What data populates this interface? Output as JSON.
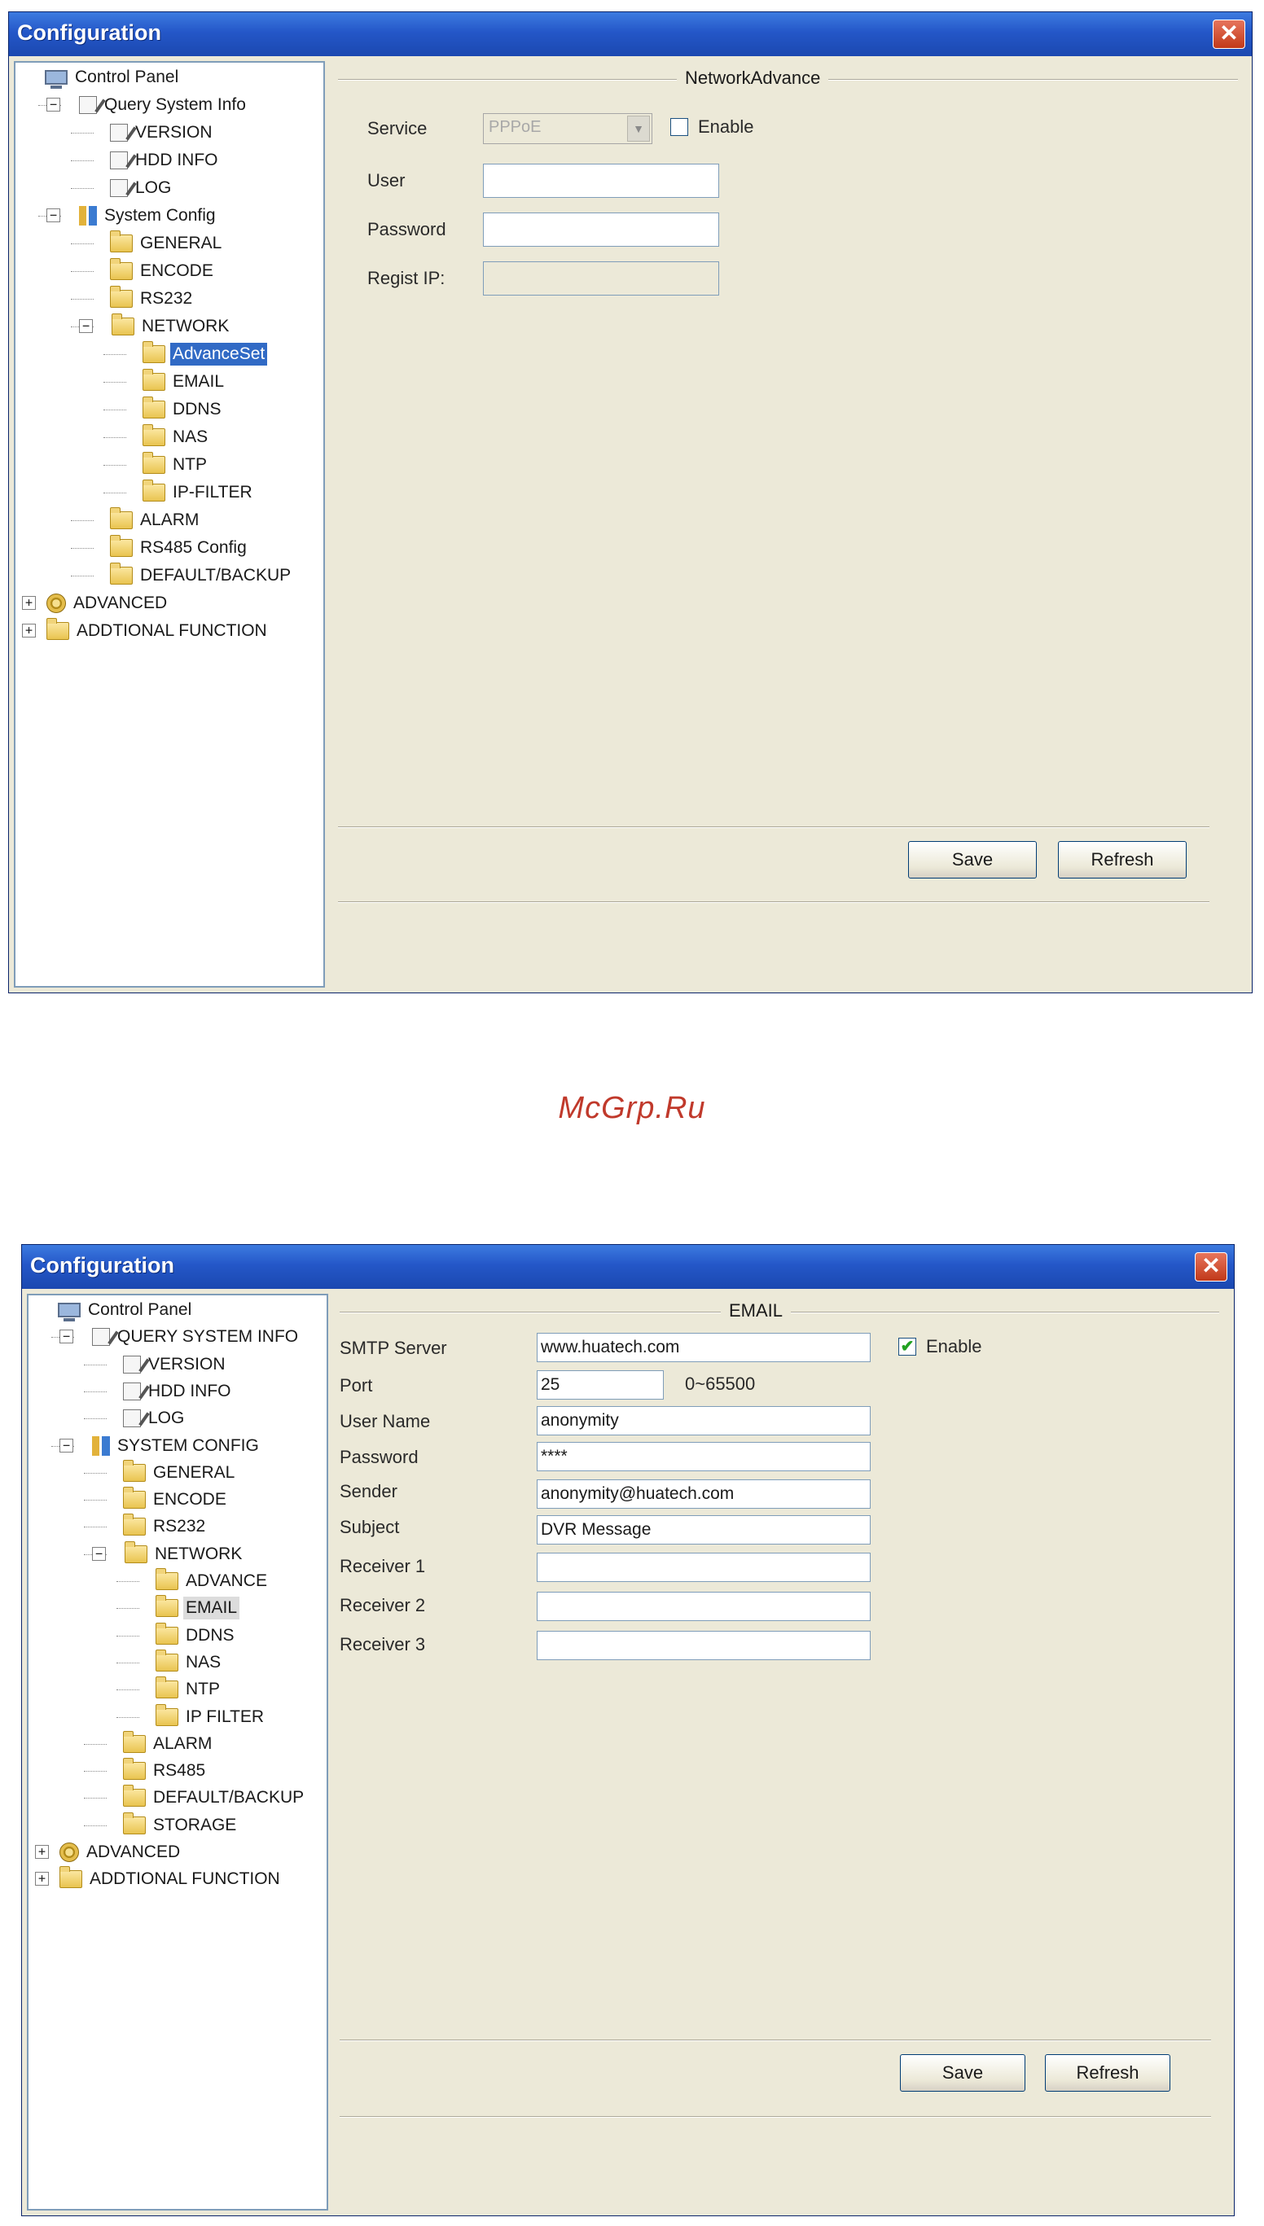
{
  "watermark": "McGrp.Ru",
  "window1": {
    "title": "Configuration",
    "close_glyph": "✕",
    "tree": [
      {
        "label": "Control Panel",
        "icon": "monitor-icon"
      },
      {
        "label": "Query System Info",
        "icon": "doc-icon",
        "expander": "−"
      },
      {
        "label": "VERSION",
        "icon": "doc-icon"
      },
      {
        "label": "HDD INFO",
        "icon": "doc-icon"
      },
      {
        "label": "LOG",
        "icon": "doc-icon"
      },
      {
        "label": "System Config",
        "icon": "tools-icon",
        "expander": "−"
      },
      {
        "label": "GENERAL",
        "icon": "folder-icon"
      },
      {
        "label": "ENCODE",
        "icon": "folder-icon"
      },
      {
        "label": "RS232",
        "icon": "folder-icon"
      },
      {
        "label": "NETWORK",
        "icon": "folder-icon",
        "expander": "−"
      },
      {
        "label": "AdvanceSet",
        "icon": "folder-icon",
        "selected": true
      },
      {
        "label": "EMAIL",
        "icon": "folder-icon"
      },
      {
        "label": "DDNS",
        "icon": "folder-icon"
      },
      {
        "label": "NAS",
        "icon": "folder-icon"
      },
      {
        "label": "NTP",
        "icon": "folder-icon"
      },
      {
        "label": "IP-FILTER",
        "icon": "folder-icon"
      },
      {
        "label": "ALARM",
        "icon": "folder-icon"
      },
      {
        "label": "RS485 Config",
        "icon": "folder-icon"
      },
      {
        "label": "DEFAULT/BACKUP",
        "icon": "folder-icon"
      },
      {
        "label": "ADVANCED",
        "icon": "gears-icon",
        "expander": "+"
      },
      {
        "label": "ADDTIONAL FUNCTION",
        "icon": "folder-icon",
        "expander": "+"
      }
    ],
    "panel": {
      "legend": "NetworkAdvance",
      "service_label": "Service",
      "service_value": "PPPoE",
      "enable_label": "Enable",
      "enable_checked": false,
      "user_label": "User",
      "user_value": "",
      "password_label": "Password",
      "password_value": "",
      "regist_ip_label": "Regist IP:",
      "regist_ip_value": "",
      "save_label": "Save",
      "refresh_label": "Refresh"
    }
  },
  "window2": {
    "title": "Configuration",
    "close_glyph": "✕",
    "tree": [
      {
        "label": "Control Panel",
        "icon": "monitor-icon"
      },
      {
        "label": "QUERY SYSTEM INFO",
        "icon": "doc-icon",
        "expander": "−"
      },
      {
        "label": "VERSION",
        "icon": "doc-icon"
      },
      {
        "label": "HDD INFO",
        "icon": "doc-icon"
      },
      {
        "label": "LOG",
        "icon": "doc-icon"
      },
      {
        "label": "SYSTEM CONFIG",
        "icon": "tools-icon",
        "expander": "−"
      },
      {
        "label": "GENERAL",
        "icon": "folder-icon"
      },
      {
        "label": "ENCODE",
        "icon": "folder-icon"
      },
      {
        "label": "RS232",
        "icon": "folder-icon"
      },
      {
        "label": "NETWORK",
        "icon": "folder-icon",
        "expander": "−"
      },
      {
        "label": "ADVANCE",
        "icon": "folder-icon"
      },
      {
        "label": "EMAIL",
        "icon": "folder-icon",
        "highlighted": true
      },
      {
        "label": "DDNS",
        "icon": "folder-icon"
      },
      {
        "label": "NAS",
        "icon": "folder-icon"
      },
      {
        "label": "NTP",
        "icon": "folder-icon"
      },
      {
        "label": "IP FILTER",
        "icon": "folder-icon"
      },
      {
        "label": "ALARM",
        "icon": "folder-icon"
      },
      {
        "label": "RS485",
        "icon": "folder-icon"
      },
      {
        "label": "DEFAULT/BACKUP",
        "icon": "folder-icon"
      },
      {
        "label": "STORAGE",
        "icon": "folder-icon"
      },
      {
        "label": "ADVANCED",
        "icon": "gears-icon",
        "expander": "+"
      },
      {
        "label": "ADDTIONAL FUNCTION",
        "icon": "folder-icon",
        "expander": "+"
      }
    ],
    "panel": {
      "legend": "EMAIL",
      "smtp_label": "SMTP Server",
      "smtp_value": "www.huatech.com",
      "enable_label": "Enable",
      "enable_checked": true,
      "port_label": "Port",
      "port_value": "25",
      "port_range": "0~65500",
      "username_label": "User Name",
      "username_value": "anonymity",
      "password_label": "Password",
      "password_value": "****",
      "sender_label": "Sender",
      "sender_value": "anonymity@huatech.com",
      "subject_label": "Subject",
      "subject_value": "DVR Message",
      "receiver1_label": "Receiver 1",
      "receiver1_value": "",
      "receiver2_label": "Receiver 2",
      "receiver2_value": "",
      "receiver3_label": "Receiver 3",
      "receiver3_value": "",
      "save_label": "Save",
      "refresh_label": "Refresh"
    }
  }
}
